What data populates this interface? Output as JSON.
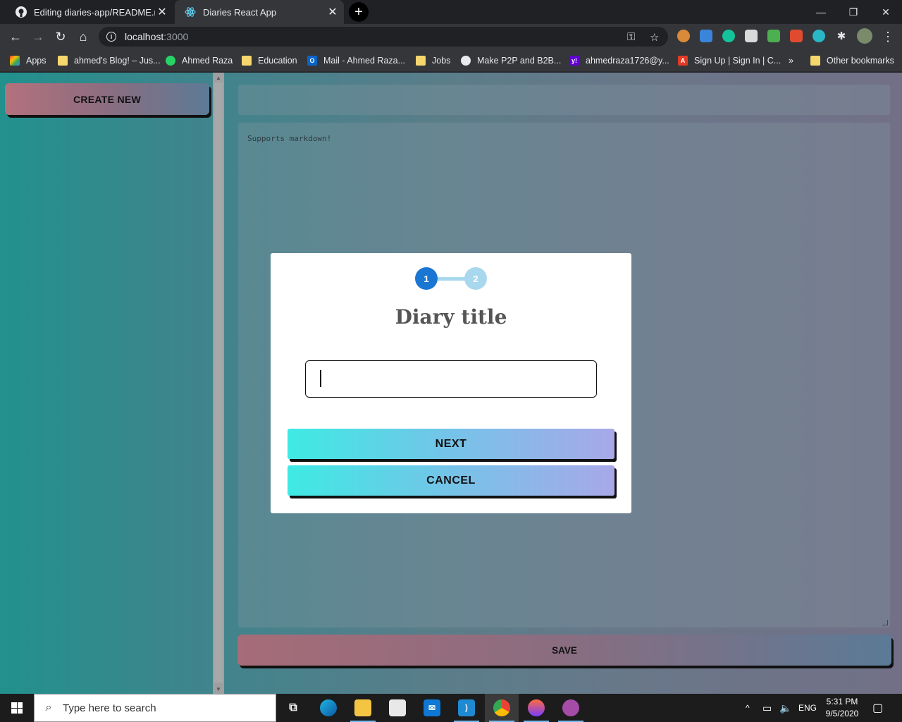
{
  "browser": {
    "tabs": [
      {
        "title": "Editing diaries-app/README.md",
        "favicon": "github-icon",
        "active": false
      },
      {
        "title": "Diaries React App",
        "favicon": "react-icon",
        "active": true
      }
    ],
    "new_tab_label": "+",
    "address": {
      "host": "localhost",
      "port": ":3000"
    },
    "window_controls": {
      "minimize": "—",
      "restore": "❐",
      "close": "✕"
    }
  },
  "bookmarks": [
    {
      "label": "Apps",
      "icon": "apps-grid-icon"
    },
    {
      "label": "ahmed's Blog! – Jus...",
      "icon": "folder-icon"
    },
    {
      "label": "Ahmed Raza",
      "icon": "whatsapp-icon"
    },
    {
      "label": "Education",
      "icon": "folder-icon"
    },
    {
      "label": "Mail - Ahmed Raza...",
      "icon": "outlook-icon"
    },
    {
      "label": "Jobs",
      "icon": "folder-icon"
    },
    {
      "label": "Make P2P and B2B...",
      "icon": "globe-icon"
    },
    {
      "label": "ahmedraza1726@y...",
      "icon": "yahoo-icon"
    },
    {
      "label": "Sign Up | Sign In | C...",
      "icon": "acrobat-icon"
    },
    {
      "label": "»",
      "icon": "overflow"
    },
    {
      "label": "Other bookmarks",
      "icon": "folder-icon"
    }
  ],
  "app": {
    "create_new_label": "CREATE NEW",
    "editor_placeholder": "Supports markdown!",
    "save_label": "SAVE"
  },
  "modal": {
    "steps": [
      "1",
      "2"
    ],
    "current_step": 1,
    "title": "Diary title",
    "input_value": "",
    "next_label": "NEXT",
    "cancel_label": "CANCEL"
  },
  "taskbar": {
    "search_placeholder": "Type here to search",
    "apps": [
      "task-view-icon",
      "edge-icon",
      "file-explorer-icon",
      "store-icon",
      "mail-icon",
      "vscode-icon",
      "chrome-icon",
      "drop-icon",
      "github-desktop-icon"
    ],
    "language": "ENG",
    "time": "5:31 PM",
    "date": "9/5/2020"
  },
  "colors": {
    "page_gradient_start": "#22918d",
    "page_gradient_end": "#727087",
    "step_active": "#1976d2",
    "step_inactive": "#a8d8ee",
    "modal_button_gradient_start": "#3eeae4",
    "modal_button_gradient_end": "#a8a8e8"
  }
}
